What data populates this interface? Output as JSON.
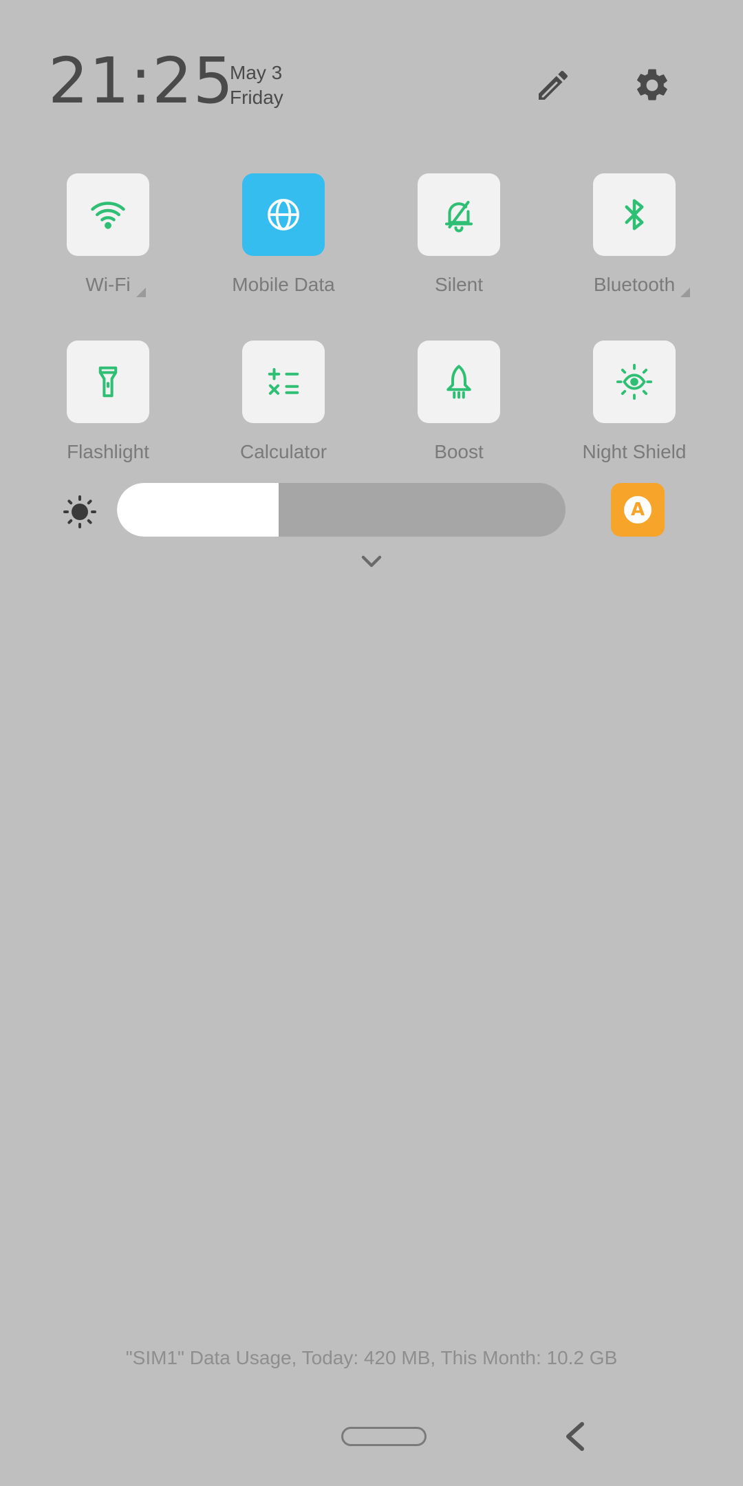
{
  "header": {
    "time": "21:25",
    "date": "May 3",
    "weekday": "Friday",
    "edit_icon": "pencil-icon",
    "settings_icon": "gear-icon"
  },
  "tiles": [
    [
      {
        "label": "Wi-Fi",
        "icon": "wifi-icon",
        "active": false,
        "expandable": true
      },
      {
        "label": "Mobile Data",
        "icon": "globe-icon",
        "active": true,
        "expandable": false
      },
      {
        "label": "Silent",
        "icon": "bell-slash-icon",
        "active": false,
        "expandable": false
      },
      {
        "label": "Bluetooth",
        "icon": "bluetooth-icon",
        "active": false,
        "expandable": true
      }
    ],
    [
      {
        "label": "Flashlight",
        "icon": "flashlight-icon",
        "active": false,
        "expandable": false
      },
      {
        "label": "Calculator",
        "icon": "calculator-icon",
        "active": false,
        "expandable": false
      },
      {
        "label": "Boost",
        "icon": "rocket-icon",
        "active": false,
        "expandable": false
      },
      {
        "label": "Night Shield",
        "icon": "eye-sun-icon",
        "active": false,
        "expandable": false
      }
    ]
  ],
  "brightness": {
    "level_percent": 36,
    "auto_label": "A",
    "auto_enabled": true
  },
  "data_usage": "\"SIM1\" Data Usage, Today: 420 MB, This Month: 10.2 GB",
  "colors": {
    "background": "#bfbfbf",
    "tile_bg": "#f2f2f2",
    "active_tile": "#35bdf0",
    "icon_green": "#2ebf74",
    "auto_orange": "#f7a42b"
  }
}
